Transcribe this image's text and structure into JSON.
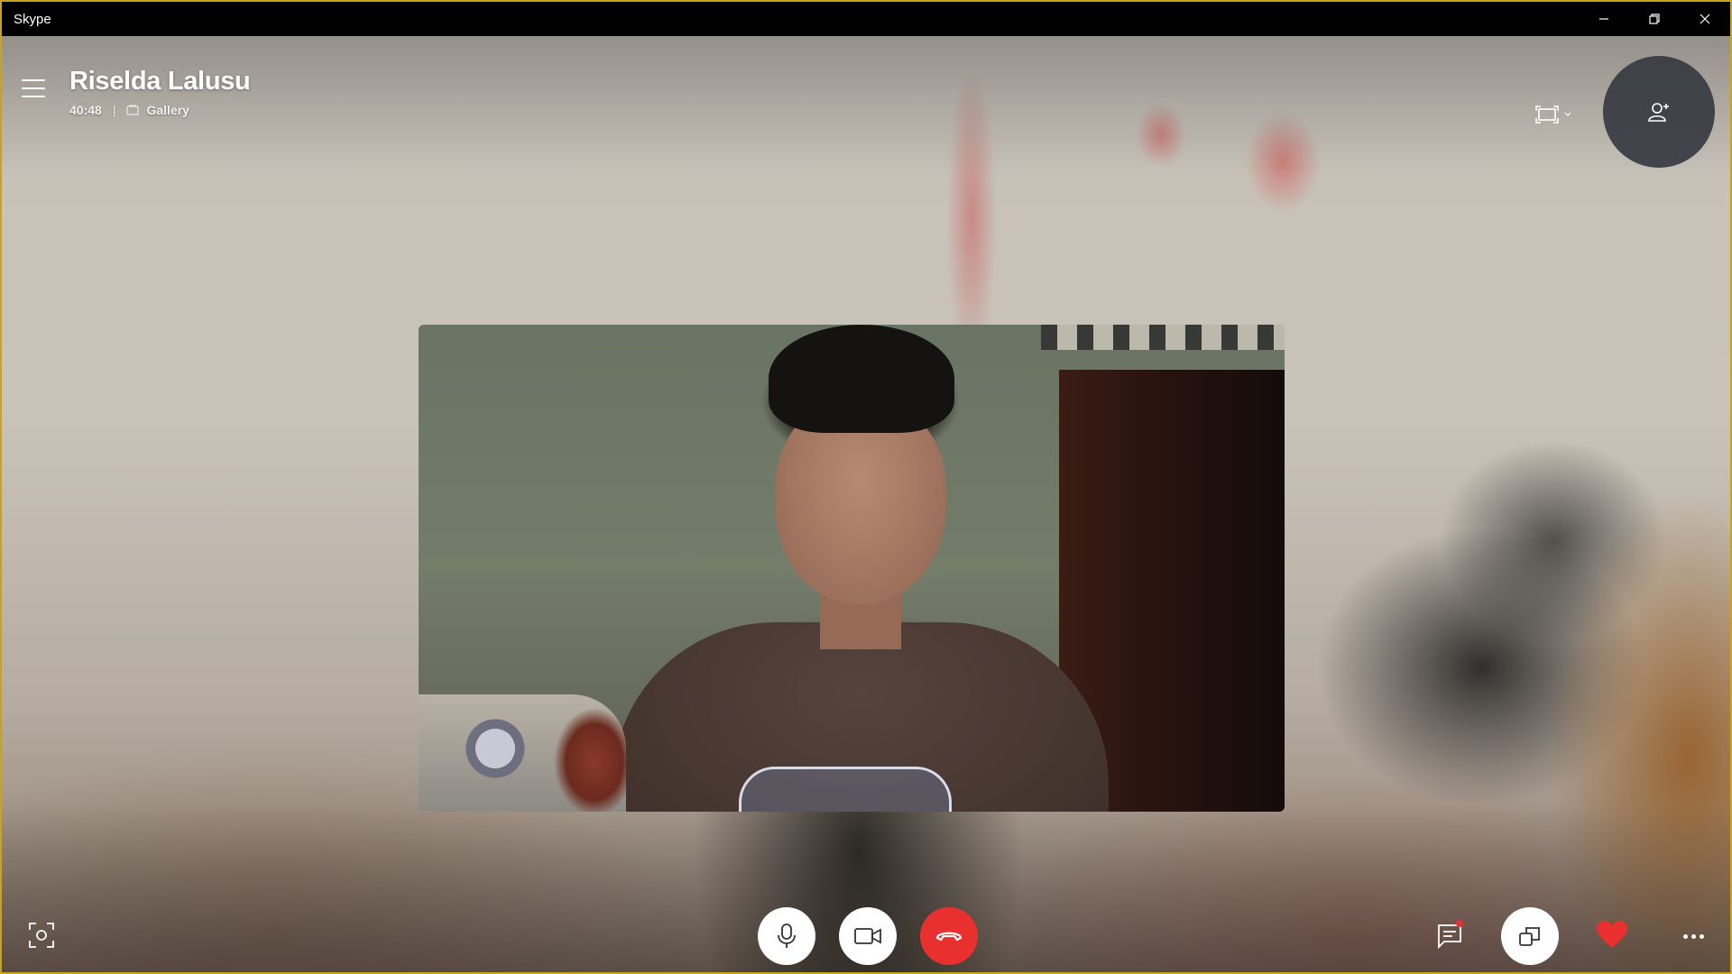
{
  "window": {
    "title": "Skype",
    "controls": {
      "minimize": "minimize-icon",
      "restore": "restore-icon",
      "close": "close-icon"
    }
  },
  "call": {
    "caller_name": "Riselda Lalusu",
    "duration": "40:48",
    "separator": "|",
    "view_mode": "Gallery"
  },
  "icons": {
    "menu": "hamburger-menu-icon",
    "layout": "screen-layout-icon",
    "add_people": "add-person-icon",
    "snapshot": "camera-snapshot-icon",
    "microphone": "microphone-icon",
    "video": "video-camera-icon",
    "end_call": "hang-up-icon",
    "chat": "chat-icon",
    "switch_view": "switch-view-icon",
    "react": "heart-icon",
    "more": "more-options-icon"
  },
  "colors": {
    "end_call": "#e8312f",
    "heart": "#e8312f",
    "notification_dot": "#e8312f",
    "window_border": "#c9a41a",
    "add_people_bg": "#373a42"
  }
}
